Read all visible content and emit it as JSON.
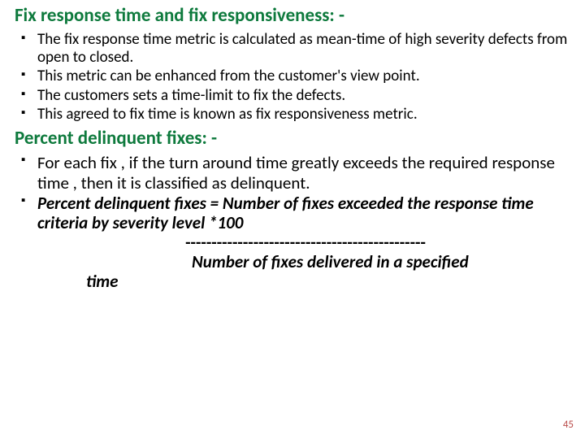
{
  "section1": {
    "heading": "Fix response  time and fix responsiveness: -",
    "items": [
      "The fix response time metric is calculated as mean-time of high severity defects from open to closed.",
      "This metric can be enhanced from the customer's view point.",
      "The customers sets a time-limit to fix the defects.",
      "This agreed to fix time is known as fix responsiveness metric."
    ]
  },
  "section2": {
    "heading": "Percent delinquent fixes: -",
    "items": [
      "For each fix , if the turn around time greatly exceeds the required response time , then it is classified as delinquent."
    ],
    "formula": {
      "lead": " Percent delinquent fixes = ",
      "numerator": "Number of fixes exceeded the response time criteria by severity level                              ",
      "star": "*100",
      "divider": "----------------------------------------------",
      "denominator": "Number of fixes delivered in a specified",
      "tail": "time"
    }
  },
  "page_number": "45"
}
